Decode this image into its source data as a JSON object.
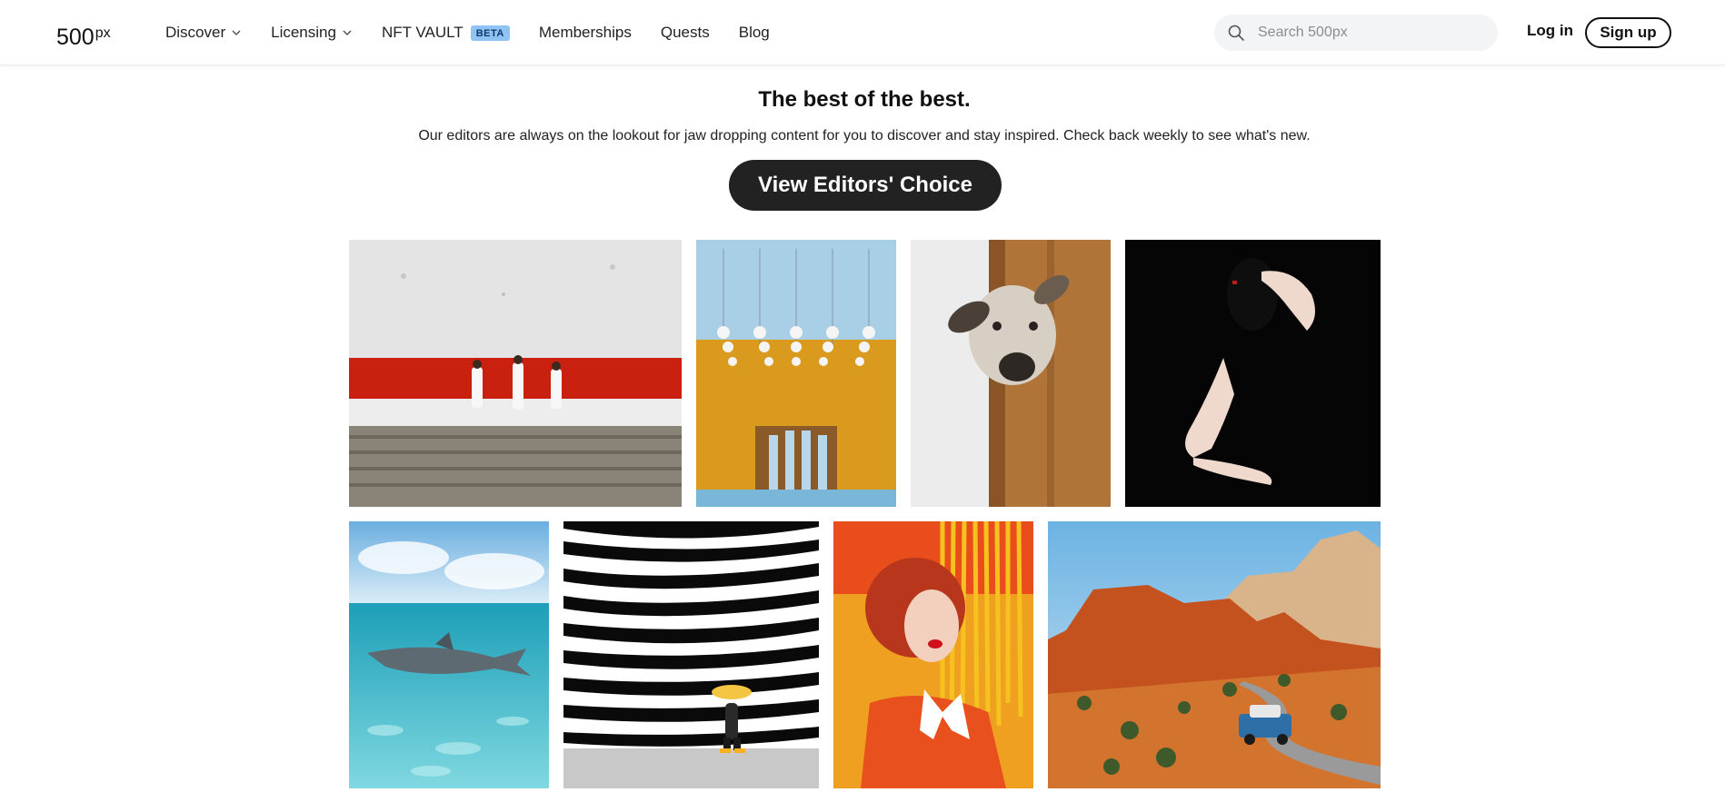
{
  "header": {
    "logo_main": "500",
    "logo_sup": "px",
    "nav": [
      {
        "label": "Discover"
      },
      {
        "label": "Licensing"
      },
      {
        "label": "NFT VAULT",
        "badge": "BETA"
      },
      {
        "label": "Memberships"
      },
      {
        "label": "Quests"
      },
      {
        "label": "Blog"
      }
    ],
    "search_placeholder": "Search 500px",
    "login_label": "Log in",
    "signup_label": "Sign up"
  },
  "hero": {
    "title": "The best of the best.",
    "subtitle": "Our editors are always on the lookout for jaw dropping content for you to discover and stay inspired. Check back weekly to see what's new.",
    "cta_label": "View Editors' Choice"
  },
  "colors": {
    "accent_dark": "#222222",
    "beta_badge": "#8fc2f5"
  },
  "gallery": {
    "photos": [
      {
        "subject": "three men in white walking along red wall"
      },
      {
        "subject": "hanging globe lamps over mustard wall with dancers"
      },
      {
        "subject": "dog peeking around wooden door"
      },
      {
        "subject": "woman in black covering face with hand"
      },
      {
        "subject": "shark swimming in turquoise water"
      },
      {
        "subject": "woman with umbrella walking past black and white stripes"
      },
      {
        "subject": "red-haired woman with yellow fringe"
      },
      {
        "subject": "blue truck on desert road among red rock cliffs"
      }
    ]
  }
}
